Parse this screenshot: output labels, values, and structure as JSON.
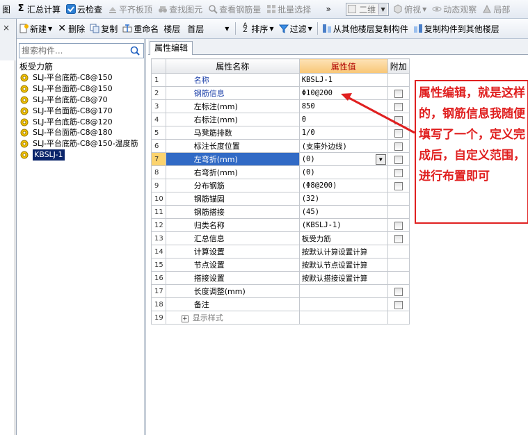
{
  "toolbar1": {
    "partial_left": "图",
    "summary": "汇总计算",
    "cloud_check": "云检查",
    "align_slab": "平齐板顶",
    "find_element": "查找图元",
    "view_rebar": "查看钢筋量",
    "batch_select": "批量选择",
    "overflow": "»",
    "view_mode": "二维",
    "view_angle": "俯视",
    "dynamic_view": "动态观察",
    "local": "局部"
  },
  "toolbar2": {
    "new": "新建",
    "delete": "删除",
    "copy": "复制",
    "rename": "重命名",
    "floor_label": "楼层",
    "floor_value": "首层",
    "sort": "排序",
    "filter": "过滤",
    "copy_from_other": "从其他楼层复制构件",
    "copy_to_other": "复制构件到其他楼层"
  },
  "left": {
    "close": "×"
  },
  "panel": {
    "search_placeholder": "搜索构件...",
    "root": "板受力筋",
    "items": [
      "SLJ-平台底筋-C8@150",
      "SLJ-平台面筋-C8@150",
      "SLJ-平台底筋-C8@70",
      "SLJ-平台面筋-C8@170",
      "SLJ-平台底筋-C8@120",
      "SLJ-平台面筋-C8@180",
      "SLJ-平台底筋-C8@150-温度筋",
      "KBSLJ-1"
    ],
    "selected_index": 7
  },
  "editor": {
    "tab": "属性编辑",
    "headers": {
      "name": "属性名称",
      "value": "属性值",
      "extra": "附加"
    },
    "rows": [
      {
        "n": "1",
        "name": "名称",
        "value": "KBSLJ-1",
        "check": false
      },
      {
        "n": "2",
        "name": "钢筋信息",
        "value": "Φ10@200",
        "check": true
      },
      {
        "n": "3",
        "name": "左标注(mm)",
        "value": "850",
        "check": true
      },
      {
        "n": "4",
        "name": "右标注(mm)",
        "value": "0",
        "check": true
      },
      {
        "n": "5",
        "name": "马凳筋排数",
        "value": "1/0",
        "check": true
      },
      {
        "n": "6",
        "name": "标注长度位置",
        "value": "(支座外边线)",
        "check": true
      },
      {
        "n": "7",
        "name": "左弯折(mm)",
        "value": "(0)",
        "check": true
      },
      {
        "n": "8",
        "name": "右弯折(mm)",
        "value": "(0)",
        "check": true
      },
      {
        "n": "9",
        "name": "分布钢筋",
        "value": "(Φ8@200)",
        "check": true
      },
      {
        "n": "10",
        "name": "钢筋锚固",
        "value": "(32)",
        "check": false
      },
      {
        "n": "11",
        "name": "钢筋搭接",
        "value": "(45)",
        "check": false
      },
      {
        "n": "12",
        "name": "归类名称",
        "value": "(KBSLJ-1)",
        "check": true
      },
      {
        "n": "13",
        "name": "汇总信息",
        "value": "板受力筋",
        "check": true
      },
      {
        "n": "14",
        "name": "计算设置",
        "value": "按默认计算设置计算",
        "check": false
      },
      {
        "n": "15",
        "name": "节点设置",
        "value": "按默认节点设置计算",
        "check": false
      },
      {
        "n": "16",
        "name": "搭接设置",
        "value": "按默认搭接设置计算",
        "check": false
      },
      {
        "n": "17",
        "name": "长度调整(mm)",
        "value": "",
        "check": true
      },
      {
        "n": "18",
        "name": "备注",
        "value": "",
        "check": true
      },
      {
        "n": "19",
        "name": "显示样式",
        "value": "",
        "check": false
      }
    ]
  },
  "annotation": {
    "text": "属性编辑，就是这样的，钢筋信息我随便填写了一个，定义完成后，自定义范围，进行布置即可",
    "color": "#e02020"
  }
}
